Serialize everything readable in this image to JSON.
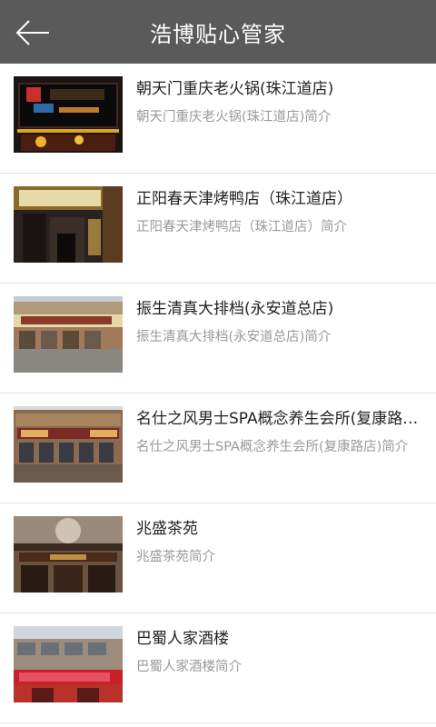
{
  "header": {
    "title": "浩博贴心管家",
    "back_icon": "arrow-left-icon"
  },
  "items": [
    {
      "name": "朝天门重庆老火锅(珠江道店)",
      "desc": "朝天门重庆老火锅(珠江道店)简介"
    },
    {
      "name": "正阳春天津烤鸭店（珠江道店）",
      "desc": "正阳春天津烤鸭店（珠江道店）简介"
    },
    {
      "name": "振生清真大排档(永安道总店)",
      "desc": "振生清真大排档(永安道总店)简介"
    },
    {
      "name": "名仕之风男士SPA概念养生会所(复康路店)",
      "desc": "名仕之风男士SPA概念养生会所(复康路店)简介"
    },
    {
      "name": "兆盛茶苑",
      "desc": "兆盛茶苑简介"
    },
    {
      "name": "巴蜀人家酒楼",
      "desc": "巴蜀人家酒楼简介"
    }
  ]
}
